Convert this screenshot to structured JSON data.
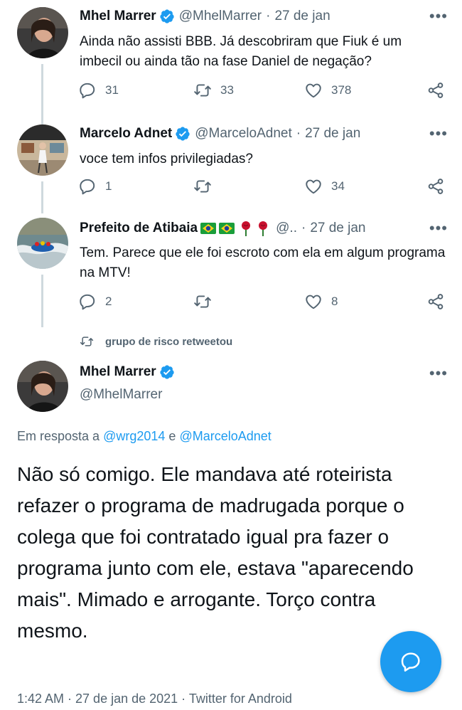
{
  "tweets": [
    {
      "name": "Mhel Marrer",
      "handle": "@MhelMarrer",
      "date": "27 de jan",
      "text": "Ainda não assisti BBB. Já descobriram que Fiuk é um imbecil ou ainda tão na fase Daniel de negação?",
      "replies": "31",
      "retweets": "33",
      "likes": "378"
    },
    {
      "name": "Marcelo Adnet",
      "handle": "@MarceloAdnet",
      "date": "27 de jan",
      "text": "voce tem infos privilegiadas?",
      "replies": "1",
      "retweets": "",
      "likes": "34"
    },
    {
      "name": "Prefeito de Atibaia",
      "handle": "@..",
      "date": "27 de jan",
      "text": "Tem. Parece que ele foi escroto com ela em algum programa na MTV!",
      "replies": "2",
      "retweets": "",
      "likes": "8"
    }
  ],
  "retweet_bar": {
    "text": "grupo de risco retweetou"
  },
  "main_tweet": {
    "name": "Mhel Marrer",
    "handle": "@MhelMarrer",
    "reply_prefix": "Em resposta a",
    "reply_user1": "@wrg2014",
    "reply_and": "e",
    "reply_user2": "@MarceloAdnet",
    "text": "Não só comigo. Ele mandava até roteirista refazer o programa de madrugada porque o colega que foi contratado igual pra fazer o programa junto com ele, estava \"aparecendo mais\". Mimado e arrogante. Torço contra mesmo.",
    "timestamp": "1:42 AM · 27 de jan de 2021 · Twitter for Android"
  },
  "icons": {
    "more": "more-dots-icon",
    "reply": "reply-icon",
    "retweet": "retweet-icon",
    "like": "heart-icon",
    "share": "share-icon",
    "verified": "verified-badge-icon",
    "compose": "compose-reply-icon"
  },
  "colors": {
    "accent": "#1d9bf0",
    "muted": "#536471",
    "text": "#0f1419"
  },
  "misc": {
    "separator": "·",
    "more_glyph": "•••"
  }
}
